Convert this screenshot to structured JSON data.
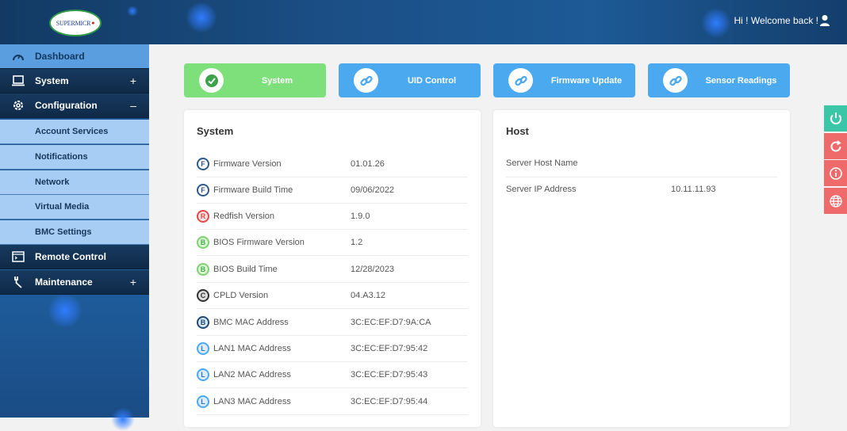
{
  "header": {
    "logo_text": "SUPERMICR",
    "welcome": "Hi ! Welcome back !"
  },
  "sidebar": {
    "items": [
      {
        "label": "Dashboard",
        "icon": "gauge-icon"
      },
      {
        "label": "System",
        "icon": "laptop-icon",
        "sign": "+"
      },
      {
        "label": "Configuration",
        "icon": "gear-icon",
        "sign": "–"
      },
      {
        "label": "Remote Control",
        "icon": "console-icon"
      },
      {
        "label": "Maintenance",
        "icon": "wrench-icon",
        "sign": "+"
      }
    ],
    "subitems": [
      {
        "label": "Account Services"
      },
      {
        "label": "Notifications"
      },
      {
        "label": "Network"
      },
      {
        "label": "Virtual Media"
      },
      {
        "label": "BMC Settings"
      }
    ]
  },
  "tiles": [
    {
      "label": "System",
      "color": "#7ee07b",
      "icon": "check-circle-icon"
    },
    {
      "label": "UID Control",
      "color": "#4aa9ef",
      "icon": "link-icon"
    },
    {
      "label": "Firmware Update",
      "color": "#4aa9ef",
      "icon": "link-icon"
    },
    {
      "label": "Sensor Readings",
      "color": "#4aa9ef",
      "icon": "link-icon"
    }
  ],
  "system_card": {
    "title": "System",
    "rows": [
      {
        "badge": "F",
        "key": "Firmware Version",
        "value": "01.01.26"
      },
      {
        "badge": "F",
        "key": "Firmware Build Time",
        "value": "09/06/2022"
      },
      {
        "badge": "R",
        "key": "Redfish Version",
        "value": "1.9.0"
      },
      {
        "badge": "B",
        "key": "BIOS Firmware Version",
        "value": "1.2"
      },
      {
        "badge": "B",
        "key": "BIOS Build Time",
        "value": "12/28/2023"
      },
      {
        "badge": "C",
        "key": "CPLD Version",
        "value": "04.A3.12"
      },
      {
        "badge": "B",
        "key": "BMC MAC Address",
        "value": "3C:EC:EF:D7:9A:CA"
      },
      {
        "badge": "L",
        "key": "LAN1 MAC Address",
        "value": "3C:EC:EF:D7:95:42"
      },
      {
        "badge": "L",
        "key": "LAN2 MAC Address",
        "value": "3C:EC:EF:D7:95:43"
      },
      {
        "badge": "L",
        "key": "LAN3 MAC Address",
        "value": "3C:EC:EF:D7:95:44"
      }
    ]
  },
  "host_card": {
    "title": "Host",
    "rows": [
      {
        "key": "Server Host Name",
        "value": ""
      },
      {
        "key": "Server IP Address",
        "value": "10.11.11.93"
      }
    ]
  },
  "side_actions": [
    {
      "icon": "power-icon",
      "color": "#3cc6a8"
    },
    {
      "icon": "refresh-icon",
      "color": "#ef6b6b"
    },
    {
      "icon": "info-icon",
      "color": "#ef6b6b"
    },
    {
      "icon": "globe-icon",
      "color": "#ef6b6b"
    }
  ]
}
